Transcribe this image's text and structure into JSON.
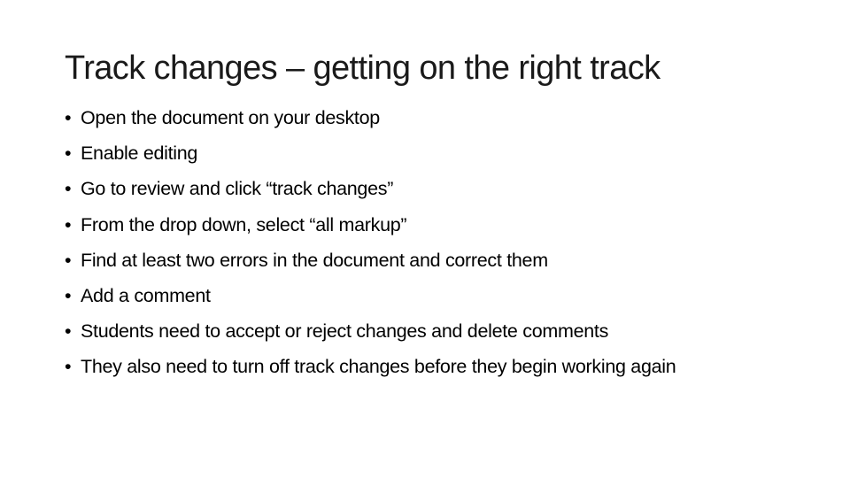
{
  "slide": {
    "title": "Track changes – getting on the right track",
    "bullet_glyph": "•",
    "bullets": [
      "Open the document on your desktop",
      "Enable editing",
      "Go to review and click “track changes”",
      "From the drop down, select “all markup”",
      "Find at least two errors in the document and correct them",
      "Add a comment",
      "Students need to accept or reject changes and delete comments",
      "They also need to turn off track changes before they begin working again"
    ]
  }
}
